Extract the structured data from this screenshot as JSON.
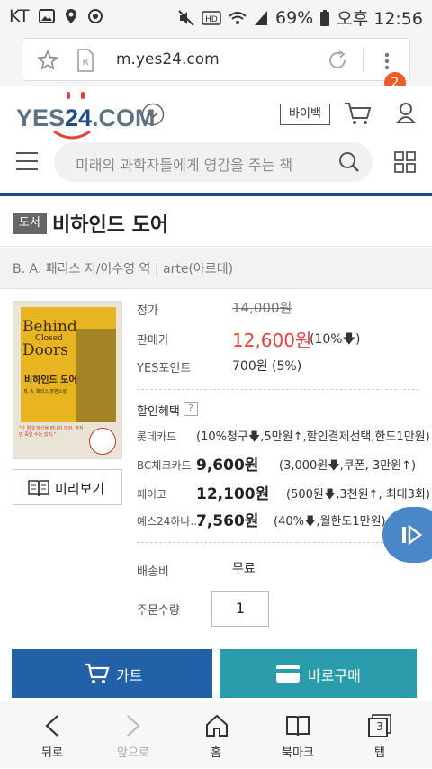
{
  "status": {
    "carrier": "KT",
    "battery": "69%",
    "time": "오후 12:56"
  },
  "browser": {
    "url": "m.yes24.com",
    "tab_count": "2"
  },
  "site": {
    "logo_text": "YES24.COM",
    "logo_yes": "YES",
    "logo_24": "24",
    "logo_com": ".COM",
    "buyback_label": "바이백",
    "search_placeholder": "미래의 과학자들에게 영감을 주는 책"
  },
  "book": {
    "category": "도서",
    "title": "비하인드 도어",
    "author_line": "B. A. 패리스 저/이수영 역",
    "publisher": "arte(아르테)",
    "cover": {
      "title_en_1": "Behind",
      "title_en_2": "Closed",
      "title_en_3": "Doors",
      "title_ko": "비하인드 도어",
      "author": "B. A. 패리스 장편소설",
      "blurb": "\"난 절대 당신을 떠나지 않아. 하지만 죽일 수는 있지.\""
    },
    "preview_label": "미리보기"
  },
  "price": {
    "list_label": "정가",
    "list_value": "14,000원",
    "sale_label": "판매가",
    "sale_value": "12,600원",
    "sale_discount": "(10%",
    "points_label": "YES포인트",
    "points_value": "700원 (5%)"
  },
  "discounts": {
    "header": "할인혜택",
    "help": "?",
    "rows": [
      {
        "label": "롯데카드",
        "detail": "(10%청구",
        "detail2": ",5만원↑,할인결제선택,한도1만원)"
      },
      {
        "label": "BC체크카드",
        "amount": "9,600원",
        "detail": "(3,000원",
        "detail2": ",쿠폰, 3만원↑)"
      },
      {
        "label": "페이코",
        "amount": "12,100원",
        "detail": "(500원",
        "detail2": ",3천원↑, 최대3회)"
      },
      {
        "label": "예스24하나...",
        "amount": "7,560원",
        "detail": "(40%",
        "detail2": ",월한도1만원)"
      }
    ]
  },
  "shipping": {
    "label": "배송비",
    "value": "무료"
  },
  "quantity": {
    "label": "주문수량",
    "value": "1"
  },
  "actions": {
    "cart_label": "카트",
    "buy_label": "바로구매"
  },
  "nav": {
    "back": "뒤로",
    "forward": "앞으로",
    "home": "홈",
    "bookmarks": "북마크",
    "tabs": "탭",
    "tabs_count": "3"
  },
  "colors": {
    "brand_blue": "#1e4c87",
    "sale_red": "#e8413b",
    "cart_blue": "#2261a8",
    "buy_teal": "#2b9cab",
    "badge_orange": "#f05a28"
  }
}
